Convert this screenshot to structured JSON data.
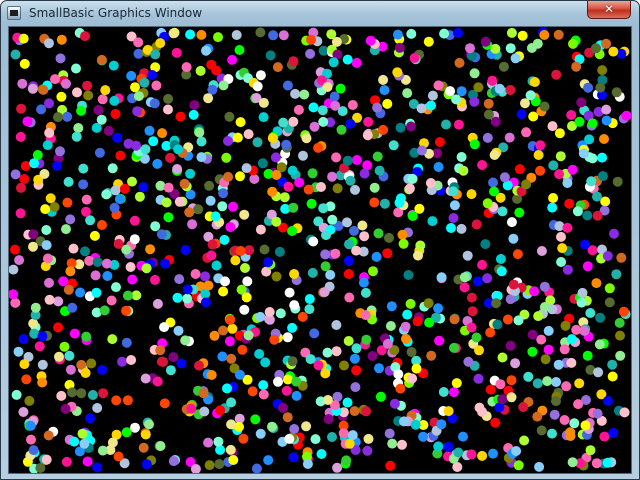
{
  "window": {
    "title": "SmallBasic Graphics Window",
    "close_glyph": "✕"
  },
  "canvas": {
    "background": "#000000",
    "content": "randomly placed filled circles of random colors",
    "palette": [
      "#ff0000",
      "#00ff00",
      "#0000ff",
      "#ffff00",
      "#ff00ff",
      "#00ffff",
      "#ff8c00",
      "#ff69b4",
      "#adff2f",
      "#7fffd4",
      "#9370db",
      "#da70d6",
      "#40e0d0",
      "#90ee90",
      "#87cefa",
      "#ffc0cb",
      "#ffffff",
      "#808000",
      "#008080",
      "#800080",
      "#ff1493",
      "#32cd32",
      "#4169e1",
      "#ff4500",
      "#ffd700",
      "#00ced1",
      "#8a2be2",
      "#dc143c",
      "#7cfc00",
      "#1e90ff",
      "#f0e68c",
      "#dda0dd",
      "#20b2aa",
      "#b0c4de",
      "#d2691e",
      "#556b2f"
    ]
  }
}
